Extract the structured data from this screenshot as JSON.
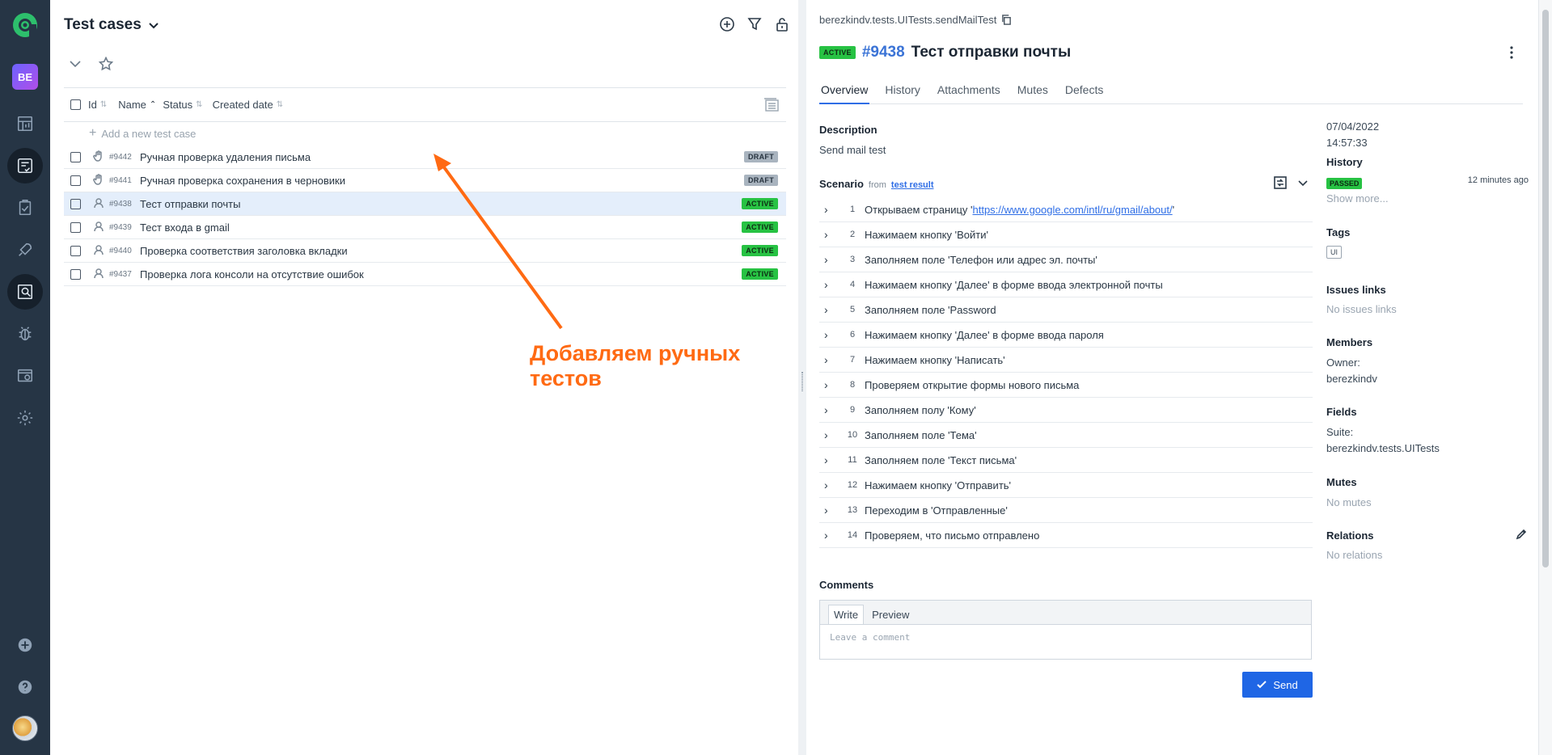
{
  "nav": {
    "project_initials": "BE",
    "items": [
      "dashboard-icon",
      "test-cases-icon",
      "test-plans-icon",
      "launches-icon",
      "analytics-icon",
      "defects-icon",
      "jobs-icon",
      "settings-icon"
    ],
    "bottom": [
      "add-icon",
      "help-icon",
      "avatar"
    ]
  },
  "list": {
    "title": "Test cases",
    "columns": {
      "id": "Id",
      "name": "Name",
      "status": "Status",
      "created": "Created date"
    },
    "add_label": "Add a new test case",
    "rows": [
      {
        "id": "#9442",
        "name": "Ручная проверка удаления письма",
        "status": "DRAFT",
        "mode": "manual"
      },
      {
        "id": "#9441",
        "name": "Ручная проверка сохранения в черновики",
        "status": "DRAFT",
        "mode": "manual"
      },
      {
        "id": "#9438",
        "name": "Тест отправки почты",
        "status": "ACTIVE",
        "mode": "automated",
        "selected": true
      },
      {
        "id": "#9439",
        "name": "Тест входа в gmail",
        "status": "ACTIVE",
        "mode": "automated"
      },
      {
        "id": "#9440",
        "name": "Проверка соответствия заголовка вкладки",
        "status": "ACTIVE",
        "mode": "automated"
      },
      {
        "id": "#9437",
        "name": "Проверка лога консоли на отсутствие ошибок",
        "status": "ACTIVE",
        "mode": "automated"
      }
    ],
    "annotation": "Добавляем ручных тестов"
  },
  "detail": {
    "path": "berezkindv.tests.UITests.sendMailTest",
    "status": "ACTIVE",
    "number": "#9438",
    "title": "Тест отправки почты",
    "tabs": [
      "Overview",
      "History",
      "Attachments",
      "Mutes",
      "Defects"
    ],
    "description_label": "Description",
    "description": "Send mail test",
    "scenario_label": "Scenario",
    "scenario_from": "from",
    "scenario_link": "test result",
    "steps": [
      {
        "n": "1",
        "prefix": "Открываем страницу '",
        "link": "https://www.google.com/intl/ru/gmail/about/",
        "suffix": "'"
      },
      {
        "n": "2",
        "text": "Нажимаем кнопку 'Войти'"
      },
      {
        "n": "3",
        "text": "Заполняем поле 'Телефон или адрес эл. почты'"
      },
      {
        "n": "4",
        "text": "Нажимаем кнопку 'Далее' в форме ввода электронной почты"
      },
      {
        "n": "5",
        "text": "Заполняем поле 'Password"
      },
      {
        "n": "6",
        "text": "Нажимаем кнопку 'Далее' в форме ввода пароля"
      },
      {
        "n": "7",
        "text": "Нажимаем кнопку 'Написать'"
      },
      {
        "n": "8",
        "text": "Проверяем открытие формы нового письма"
      },
      {
        "n": "9",
        "text": "Заполняем полу 'Кому'"
      },
      {
        "n": "10",
        "text": "Заполняем поле 'Тема'"
      },
      {
        "n": "11",
        "text": "Заполняем поле 'Текст письма'"
      },
      {
        "n": "12",
        "text": "Нажимаем кнопку 'Отправить'"
      },
      {
        "n": "13",
        "text": "Переходим в 'Отправленные'"
      },
      {
        "n": "14",
        "text": "Проверяем, что письмо отправлено"
      }
    ],
    "comments_label": "Comments",
    "comment_tabs": [
      "Write",
      "Preview"
    ],
    "comment_placeholder": "Leave a comment",
    "send_label": "Send",
    "side": {
      "date": "07/04/2022",
      "time": "14:57:33",
      "history_label": "History",
      "history_status": "PASSED",
      "history_ago": "12 minutes ago",
      "show_more": "Show more...",
      "tags_label": "Tags",
      "tag": "UI",
      "issues_label": "Issues links",
      "issues_empty": "No issues links",
      "members_label": "Members",
      "owner_label": "Owner:",
      "owner": "berezkindv",
      "fields_label": "Fields",
      "suite_label": "Suite:",
      "suite": "berezkindv.tests.UITests",
      "mutes_label": "Mutes",
      "mutes_empty": "No mutes",
      "relations_label": "Relations",
      "relations_empty": "No relations"
    }
  },
  "colors": {
    "sidebar": "#263545",
    "accent": "#1f66e5",
    "active_badge": "#27c243",
    "draft_badge": "#a9b4bf",
    "annotation": "#ff6a13",
    "id_link": "#3a73d6"
  }
}
